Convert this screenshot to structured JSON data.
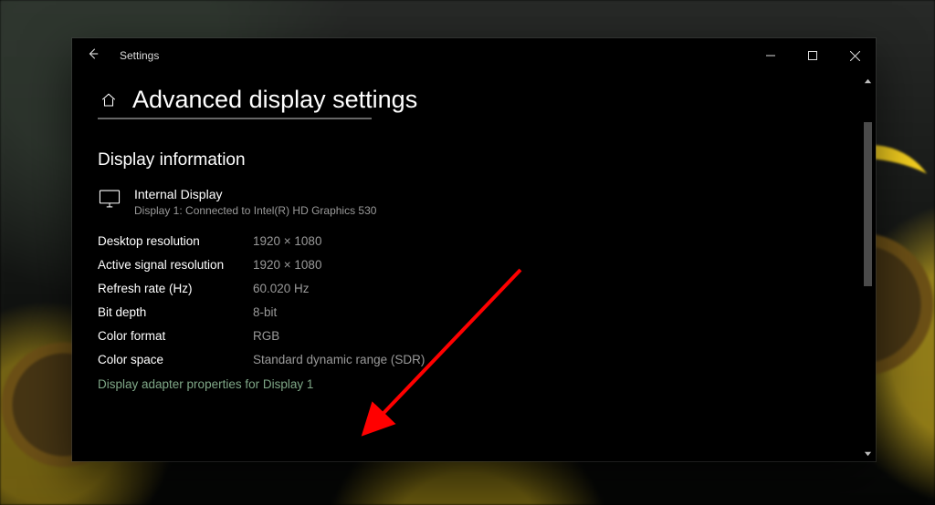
{
  "window": {
    "app_title": "Settings"
  },
  "page": {
    "title": "Advanced display settings"
  },
  "section": {
    "heading": "Display information"
  },
  "display": {
    "name": "Internal Display",
    "sub": "Display 1: Connected to Intel(R) HD Graphics 530"
  },
  "props": {
    "desktop_resolution": {
      "k": "Desktop resolution",
      "v": "1920 × 1080"
    },
    "active_signal_resolution": {
      "k": "Active signal resolution",
      "v": "1920 × 1080"
    },
    "refresh_rate": {
      "k": "Refresh rate (Hz)",
      "v": "60.020 Hz"
    },
    "bit_depth": {
      "k": "Bit depth",
      "v": "8-bit"
    },
    "color_format": {
      "k": "Color format",
      "v": "RGB"
    },
    "color_space": {
      "k": "Color space",
      "v": "Standard dynamic range (SDR)"
    }
  },
  "link": {
    "adapter_properties": "Display adapter properties for Display 1"
  }
}
